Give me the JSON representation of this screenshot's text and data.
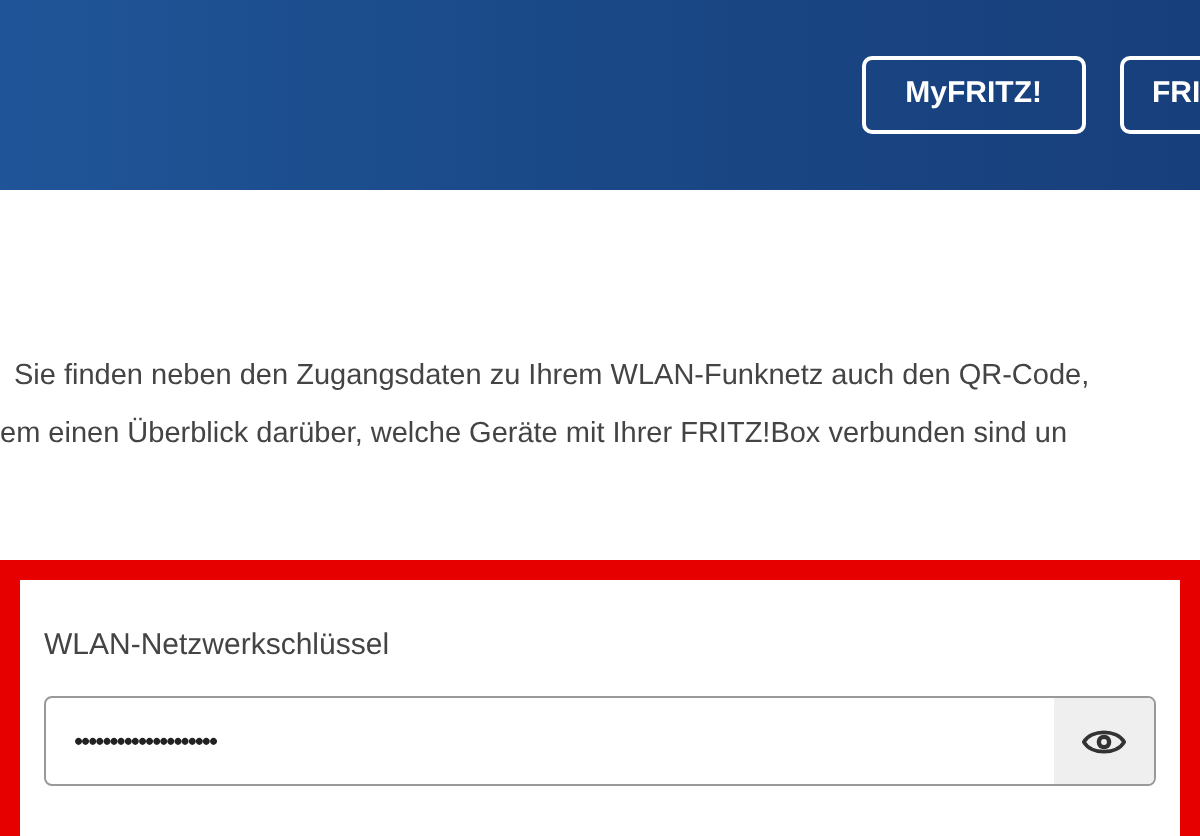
{
  "header": {
    "buttons": [
      {
        "label": "MyFRITZ!"
      },
      {
        "label": "FRI"
      }
    ]
  },
  "intro": {
    "lines": [
      "Sie finden neben den Zugangsdaten zu Ihrem WLAN-Funknetz auch den QR-Code,",
      "em einen Überblick darüber, welche Geräte mit Ihrer FRITZ!Box verbunden sind un"
    ]
  },
  "key_field": {
    "label": "WLAN-Netzwerkschlüssel",
    "value": "••••••••••••••••••••",
    "highlighted": true
  }
}
